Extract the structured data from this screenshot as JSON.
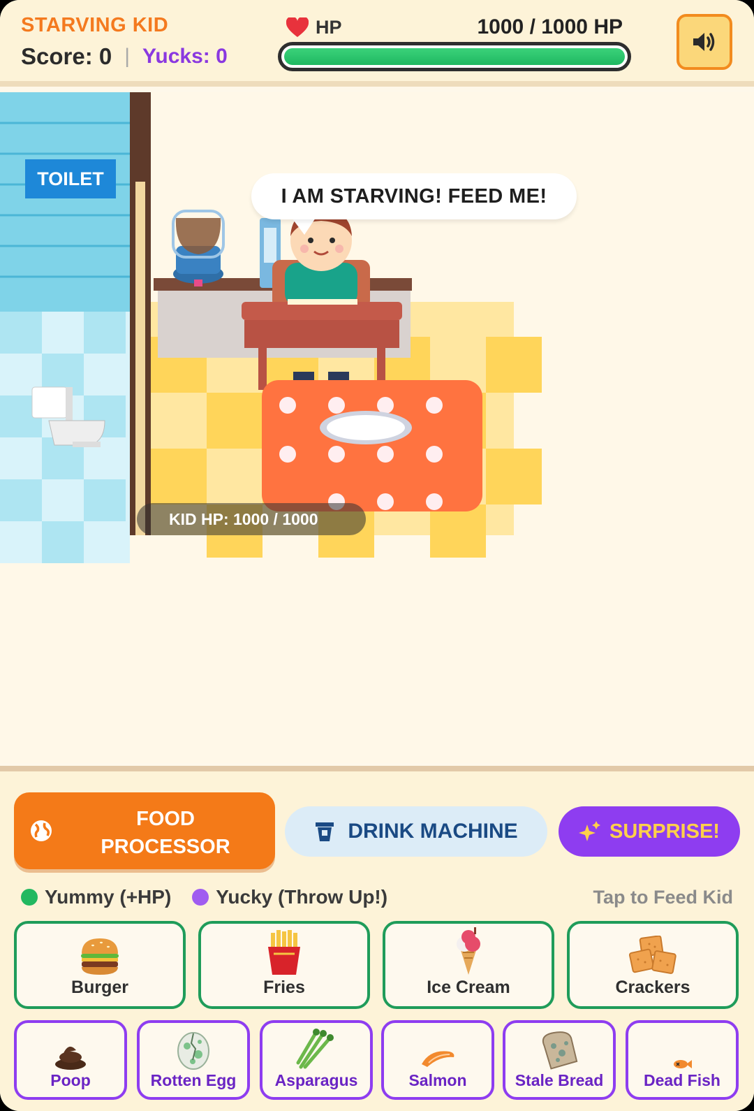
{
  "header": {
    "title": "STARVING KID",
    "score_label": "Score: 0",
    "separator": "|",
    "yucks_label": "Yucks: 0",
    "hp_label": "HP",
    "hp_value_text": "1000 / 1000 HP",
    "hp_current": 1000,
    "hp_max": 1000,
    "sound_icon": "speaker-icon"
  },
  "scene": {
    "toilet_sign": "TOILET",
    "speech": "I AM STARVING! FEED ME!",
    "kid_hp_text": "KID HP: 1000 / 1000"
  },
  "actions": {
    "food_processor": "FOOD PROCESSOR",
    "drink_machine": "DRINK MACHINE",
    "surprise": "SURPRISE!"
  },
  "legend": {
    "yummy": "Yummy (+HP)",
    "yucky": "Yucky (Throw Up!)",
    "hint": "Tap to Feed Kid",
    "yummy_color": "#22b860",
    "yucky_color": "#a05cf0"
  },
  "foods_yummy": [
    {
      "label": "Burger",
      "icon": "burger-icon"
    },
    {
      "label": "Fries",
      "icon": "fries-icon"
    },
    {
      "label": "Ice Cream",
      "icon": "ice-cream-icon"
    },
    {
      "label": "Crackers",
      "icon": "crackers-icon"
    }
  ],
  "foods_yucky": [
    {
      "label": "Poop",
      "icon": "poop-icon"
    },
    {
      "label": "Rotten Egg",
      "icon": "rotten-egg-icon"
    },
    {
      "label": "Asparagus",
      "icon": "asparagus-icon"
    },
    {
      "label": "Salmon",
      "icon": "salmon-icon"
    },
    {
      "label": "Stale Bread",
      "icon": "stale-bread-icon"
    },
    {
      "label": "Dead Fish",
      "icon": "dead-fish-icon"
    }
  ],
  "colors": {
    "accent_orange": "#f47a18",
    "accent_purple": "#8e3df0",
    "hp_green": "#22b860"
  }
}
